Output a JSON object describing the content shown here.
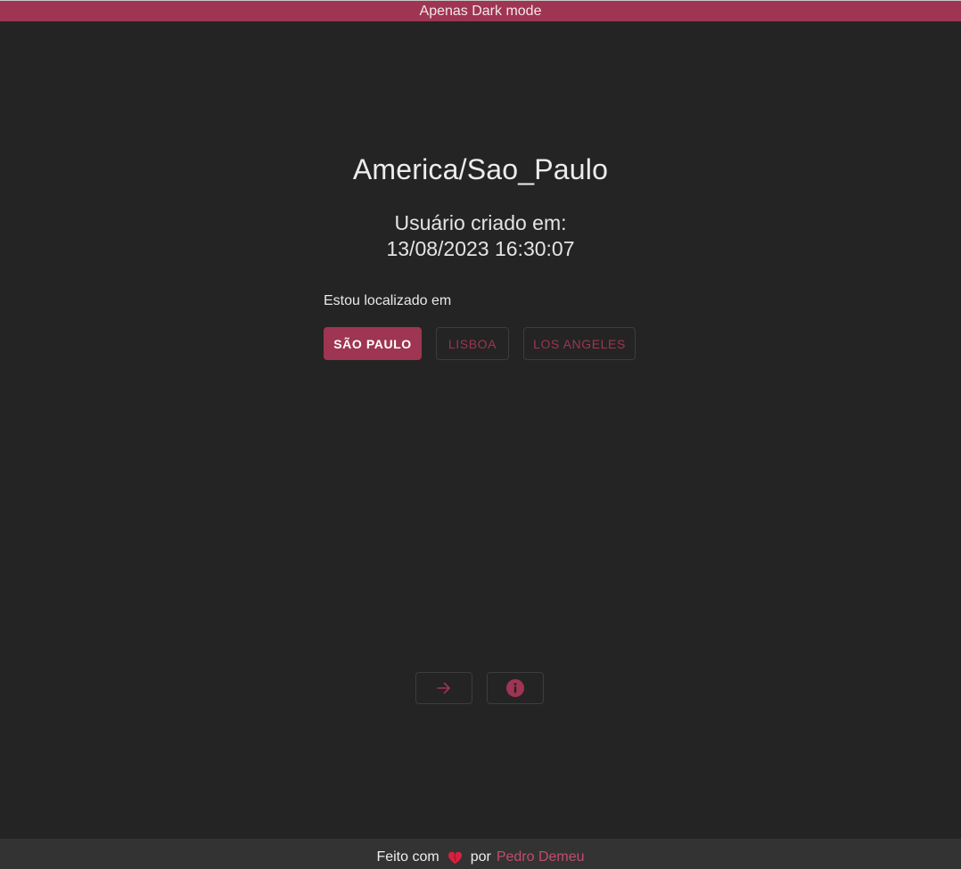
{
  "banner": {
    "text": "Apenas Dark mode"
  },
  "timezone": {
    "name": "America/Sao_Paulo"
  },
  "created": {
    "label": "Usuário criado em:",
    "datetime": "13/08/2023 16:30:07"
  },
  "location": {
    "label": "Estou localizado em",
    "options": [
      "São Paulo",
      "Lisboa",
      "Los Angeles"
    ],
    "selected": "São Paulo"
  },
  "actions": {
    "next_icon": "arrow-right-icon",
    "info_icon": "info-icon"
  },
  "footer": {
    "prefix": "Feito com",
    "heart_icon": "heart-icon",
    "middle": "por",
    "author": "Pedro Demeu"
  },
  "colors": {
    "accent": "#9e3552",
    "background": "#242424",
    "footer_bg": "#333333",
    "link": "#c14d6d"
  }
}
